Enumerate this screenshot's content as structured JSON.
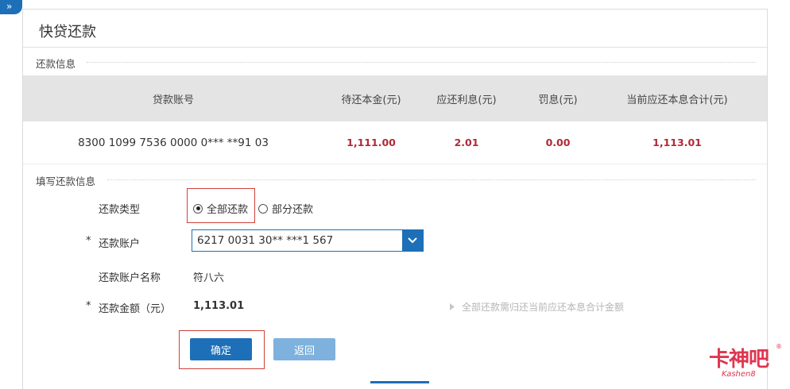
{
  "corner_tab": {
    "glyph": "»"
  },
  "panel": {
    "title": "快贷还款"
  },
  "repayment_info": {
    "section_label": "还款信息",
    "headers": [
      "贷款账号",
      "待还本金(元)",
      "应还利息(元)",
      "罚息(元)",
      "当前应还本息合计(元)"
    ],
    "row": {
      "account": "8300 1099 7536 0000 0*** **91 03",
      "principal": "1,111.00",
      "interest": "2.01",
      "penalty": "0.00",
      "total": "1,113.01"
    }
  },
  "form": {
    "section_label": "填写还款信息",
    "type_label": "还款类型",
    "type_options": [
      {
        "label": "全部还款",
        "checked": true
      },
      {
        "label": "部分还款",
        "checked": false
      }
    ],
    "required_mark": "*",
    "account_label": "还款账户",
    "account_value": "6217 0031 30** ***1 567",
    "account_name_label": "还款账户名称",
    "account_name_value": "符八六",
    "amount_label": "还款金额（元）",
    "amount_value": "1,113.01",
    "hint": "全部还款需归还当前应还本息合计金额"
  },
  "buttons": {
    "confirm": "确定",
    "back": "返回"
  },
  "watermark": {
    "main": "卡神吧",
    "sub": "Kashen8",
    "reg": "®"
  },
  "colors": {
    "accent": "#1d6fb8",
    "amount_red": "#b02a37",
    "highlight_box": "#d0403a"
  }
}
